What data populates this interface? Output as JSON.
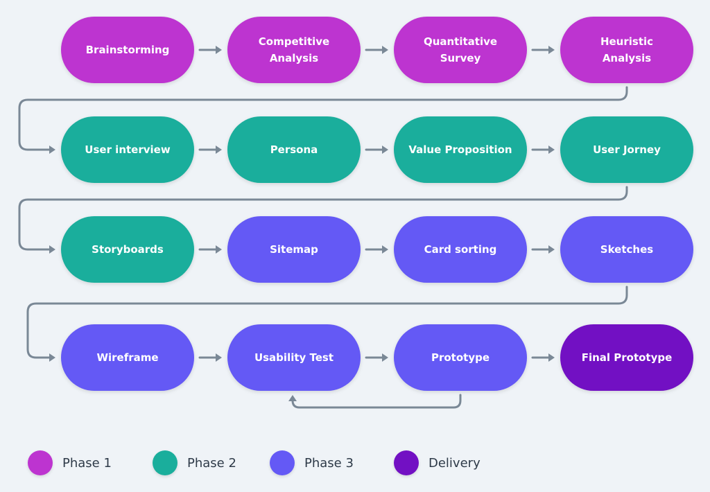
{
  "colors": {
    "phase1": "#bd34d0",
    "phase2": "#1aae9c",
    "phase3": "#6459f5",
    "delivery": "#7210c3",
    "connector": "#7a8896"
  },
  "nodes": [
    {
      "label": "Brainstorming",
      "phase": "phase1"
    },
    {
      "label": "Competitive\nAnalysis",
      "phase": "phase1"
    },
    {
      "label": "Quantitative\nSurvey",
      "phase": "phase1"
    },
    {
      "label": "Heuristic\nAnalysis",
      "phase": "phase1"
    },
    {
      "label": "User interview",
      "phase": "phase2"
    },
    {
      "label": "Persona",
      "phase": "phase2"
    },
    {
      "label": "Value Proposition",
      "phase": "phase2"
    },
    {
      "label": "User Jorney",
      "phase": "phase2"
    },
    {
      "label": "Storyboards",
      "phase": "phase2"
    },
    {
      "label": "Sitemap",
      "phase": "phase3"
    },
    {
      "label": "Card sorting",
      "phase": "phase3"
    },
    {
      "label": "Sketches",
      "phase": "phase3"
    },
    {
      "label": "Wireframe",
      "phase": "phase3"
    },
    {
      "label": "Usability Test",
      "phase": "phase3"
    },
    {
      "label": "Prototype",
      "phase": "phase3"
    },
    {
      "label": "Final Prototype",
      "phase": "delivery"
    }
  ],
  "edges": [
    [
      0,
      1
    ],
    [
      1,
      2
    ],
    [
      2,
      3
    ],
    [
      3,
      4
    ],
    [
      4,
      5
    ],
    [
      5,
      6
    ],
    [
      6,
      7
    ],
    [
      7,
      8
    ],
    [
      8,
      9
    ],
    [
      9,
      10
    ],
    [
      10,
      11
    ],
    [
      11,
      12
    ],
    [
      12,
      13
    ],
    [
      13,
      14
    ],
    [
      14,
      15
    ],
    [
      14,
      13
    ]
  ],
  "legend": [
    {
      "label": "Phase 1",
      "phase": "phase1"
    },
    {
      "label": "Phase 2",
      "phase": "phase2"
    },
    {
      "label": "Phase 3",
      "phase": "phase3"
    },
    {
      "label": "Delivery",
      "phase": "delivery"
    }
  ]
}
